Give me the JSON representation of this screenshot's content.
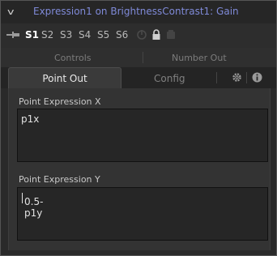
{
  "header": {
    "title": "Expression1 on BrightnessContrast1: Gain"
  },
  "slots": [
    "S1",
    "S2",
    "S3",
    "S4",
    "S5",
    "S6"
  ],
  "tabs_row1": [
    "Controls",
    "Number Out"
  ],
  "tabs_row2": [
    "Point Out",
    "Config"
  ],
  "fields": {
    "x_label": "Point Expression X",
    "x_value": "p1x",
    "y_label": "Point Expression Y",
    "y_value": "0.5-p1y"
  },
  "icons": [
    "chevron-down-icon",
    "pin-icon",
    "power-icon",
    "lock-icon",
    "reset-icon",
    "gear-icon",
    "info-icon"
  ],
  "colors": {
    "title": "#7f8ad8",
    "active_slot": "#ffffff",
    "panel": "#2a2a2a"
  }
}
